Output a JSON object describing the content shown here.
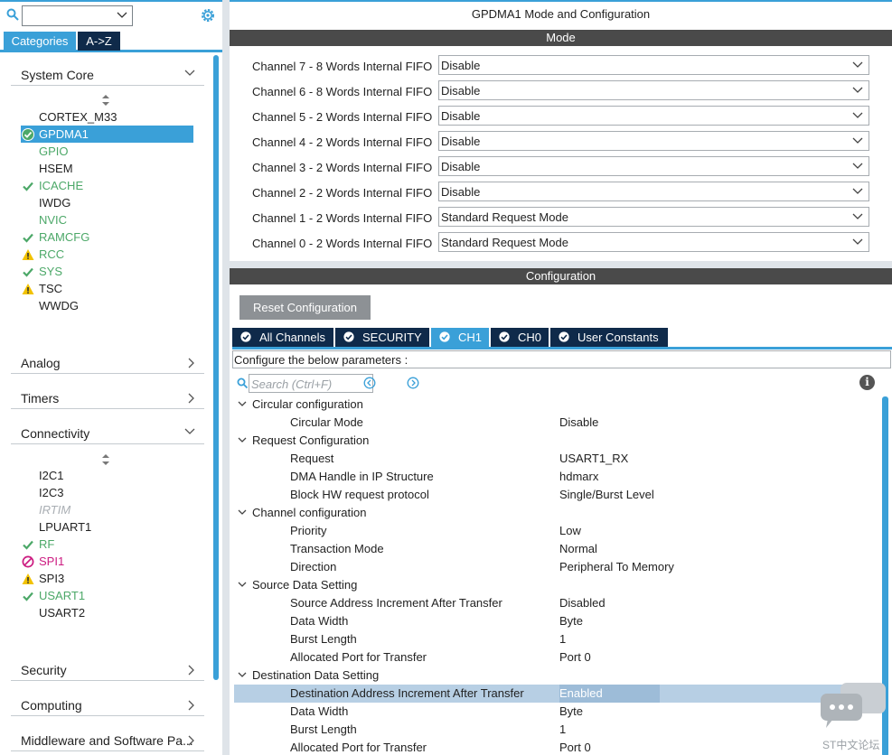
{
  "left": {
    "tabs": {
      "categories": "Categories",
      "az": "A->Z"
    },
    "system_core": {
      "label": "System Core",
      "items": [
        {
          "label": "CORTEX_M33",
          "status": "none",
          "color": "dark"
        },
        {
          "label": "GPDMA1",
          "status": "ok",
          "color": "sel"
        },
        {
          "label": "GPIO",
          "status": "none",
          "color": "green"
        },
        {
          "label": "HSEM",
          "status": "none",
          "color": "dark"
        },
        {
          "label": "ICACHE",
          "status": "check",
          "color": "green"
        },
        {
          "label": "IWDG",
          "status": "none",
          "color": "dark"
        },
        {
          "label": "NVIC",
          "status": "none",
          "color": "green"
        },
        {
          "label": "RAMCFG",
          "status": "check",
          "color": "green"
        },
        {
          "label": "RCC",
          "status": "warn",
          "color": "green"
        },
        {
          "label": "SYS",
          "status": "check",
          "color": "green"
        },
        {
          "label": "TSC",
          "status": "warn",
          "color": "dark"
        },
        {
          "label": "WWDG",
          "status": "none",
          "color": "dark"
        }
      ]
    },
    "analog": "Analog",
    "timers": "Timers",
    "connectivity": {
      "label": "Connectivity",
      "items": [
        {
          "label": "I2C1",
          "status": "none",
          "color": "dark"
        },
        {
          "label": "I2C3",
          "status": "none",
          "color": "dark"
        },
        {
          "label": "IRTIM",
          "status": "none",
          "color": "disabled"
        },
        {
          "label": "LPUART1",
          "status": "none",
          "color": "dark"
        },
        {
          "label": "RF",
          "status": "check",
          "color": "green"
        },
        {
          "label": "SPI1",
          "status": "forbid",
          "color": "pink"
        },
        {
          "label": "SPI3",
          "status": "warn",
          "color": "dark"
        },
        {
          "label": "USART1",
          "status": "check",
          "color": "green"
        },
        {
          "label": "USART2",
          "status": "none",
          "color": "dark"
        }
      ]
    },
    "security": "Security",
    "computing": "Computing",
    "middleware": "Middleware and Software Pa..."
  },
  "right": {
    "title": "GPDMA1 Mode and Configuration",
    "mode_header": "Mode",
    "channels": [
      {
        "label": "Channel 7  - 8 Words Internal FIFO",
        "value": "Disable"
      },
      {
        "label": "Channel 6  - 8 Words Internal FIFO",
        "value": "Disable"
      },
      {
        "label": "Channel 5  - 2 Words Internal FIFO",
        "value": "Disable"
      },
      {
        "label": "Channel 4  - 2 Words Internal FIFO",
        "value": "Disable"
      },
      {
        "label": "Channel 3  - 2 Words Internal FIFO",
        "value": "Disable"
      },
      {
        "label": "Channel 2  - 2 Words Internal FIFO",
        "value": "Disable"
      },
      {
        "label": "Channel 1  - 2 Words Internal FIFO",
        "value": "Standard Request Mode"
      },
      {
        "label": "Channel 0  - 2 Words Internal FIFO",
        "value": "Standard Request Mode"
      }
    ],
    "config_header": "Configuration",
    "reset_label": "Reset Configuration",
    "tabs": [
      {
        "label": "All Channels",
        "active": false
      },
      {
        "label": "SECURITY",
        "active": false
      },
      {
        "label": "CH1",
        "active": true
      },
      {
        "label": "CH0",
        "active": false
      },
      {
        "label": "User Constants",
        "active": false
      }
    ],
    "configure_text": "Configure the below parameters :",
    "search_placeholder": "Search (Ctrl+F)",
    "info_glyph": "i",
    "params": [
      {
        "type": "group",
        "label": "Circular configuration"
      },
      {
        "type": "param",
        "key": "Circular Mode",
        "value": "Disable"
      },
      {
        "type": "group",
        "label": "Request Configuration"
      },
      {
        "type": "param",
        "key": "Request",
        "value": "USART1_RX"
      },
      {
        "type": "param",
        "key": "DMA Handle in IP Structure",
        "value": "hdmarx"
      },
      {
        "type": "param",
        "key": "Block HW request protocol",
        "value": "Single/Burst Level"
      },
      {
        "type": "group",
        "label": "Channel configuration"
      },
      {
        "type": "param",
        "key": "Priority",
        "value": "Low"
      },
      {
        "type": "param",
        "key": "Transaction Mode",
        "value": "Normal"
      },
      {
        "type": "param",
        "key": "Direction",
        "value": "Peripheral To Memory"
      },
      {
        "type": "group",
        "label": "Source Data Setting"
      },
      {
        "type": "param",
        "key": "Source Address Increment After Transfer",
        "value": "Disabled"
      },
      {
        "type": "param",
        "key": "Data Width",
        "value": "Byte"
      },
      {
        "type": "param",
        "key": "Burst Length",
        "value": "1"
      },
      {
        "type": "param",
        "key": "Allocated Port for Transfer",
        "value": "Port 0"
      },
      {
        "type": "group",
        "label": "Destination Data Setting"
      },
      {
        "type": "param",
        "key": "Destination Address Increment After Transfer",
        "value": "Enabled",
        "highlight": true
      },
      {
        "type": "param",
        "key": "Data Width",
        "value": "Byte"
      },
      {
        "type": "param",
        "key": "Burst Length",
        "value": "1"
      },
      {
        "type": "param",
        "key": "Allocated Port for Transfer",
        "value": "Port 0"
      }
    ],
    "watermark": "ST中文论坛"
  },
  "colors": {
    "accent": "#3aa0d8",
    "navy": "#0f2a4a",
    "ok_green": "#4ca868",
    "warn": "#f2c200",
    "forbid": "#cc1b80"
  }
}
